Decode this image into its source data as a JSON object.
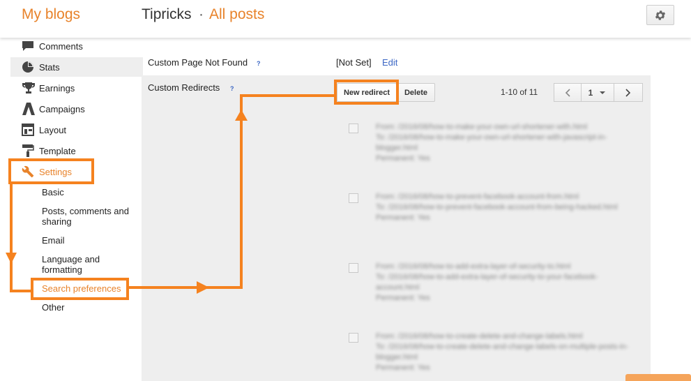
{
  "header": {
    "brand": "My blogs",
    "blog_name": "Tipricks",
    "separator": "·",
    "section": "All posts",
    "settings_icon": "gear-icon"
  },
  "sidebar": {
    "items": [
      {
        "label": "Comments",
        "icon": "comment-icon"
      },
      {
        "label": "Stats",
        "icon": "pie-chart-icon"
      },
      {
        "label": "Earnings",
        "icon": "trophy-icon"
      },
      {
        "label": "Campaigns",
        "icon": "campaigns-icon"
      },
      {
        "label": "Layout",
        "icon": "layout-icon"
      },
      {
        "label": "Template",
        "icon": "paint-roller-icon"
      },
      {
        "label": "Settings",
        "icon": "wrench-icon"
      }
    ],
    "settings_sub": [
      "Basic",
      "Posts, comments and sharing",
      "Email",
      "Language and formatting",
      "Search preferences",
      "Other"
    ]
  },
  "main": {
    "custom_404_label": "Custom Page Not Found",
    "custom_404_value": "[Not Set]",
    "custom_404_edit": "Edit",
    "help_glyph": "?",
    "custom_redirects_label": "Custom Redirects",
    "new_redirect": "New redirect",
    "delete": "Delete",
    "range": "1-10 of 11",
    "page": "1",
    "redirects": [
      {
        "from_label": "From:",
        "from": "/2016/08/how-to-make-your-own-url-shortener-with.html",
        "to_label": "To:",
        "to": "/2016/08/how-to-make-your-own-url-shortener-with-javascript-in-blogger.html",
        "permanent_label": "Permanent:",
        "permanent": "Yes"
      },
      {
        "from_label": "From:",
        "from": "/2016/08/how-to-prevent-facebook-account-from.html",
        "to_label": "To:",
        "to": "/2016/08/how-to-prevent-facebook-account-from-being-hacked.html",
        "permanent_label": "Permanent:",
        "permanent": "Yes"
      },
      {
        "from_label": "From:",
        "from": "/2016/08/how-to-add-extra-layer-of-security-to.html",
        "to_label": "To:",
        "to": "/2016/08/how-to-add-extra-layer-of-security-to-your-facebook-account.html",
        "permanent_label": "Permanent:",
        "permanent": "Yes"
      },
      {
        "from_label": "From:",
        "from": "/2016/08/how-to-create-delete-and-change-labels.html",
        "to_label": "To:",
        "to": "/2016/08/how-to-create-delete-and-change-labels-on-multiple-posts-in-blogger.html",
        "permanent_label": "Permanent:",
        "permanent": "Yes"
      }
    ]
  },
  "colors": {
    "accent": "#e8832b",
    "annotation": "#f5821f",
    "link": "#3b66c4"
  }
}
